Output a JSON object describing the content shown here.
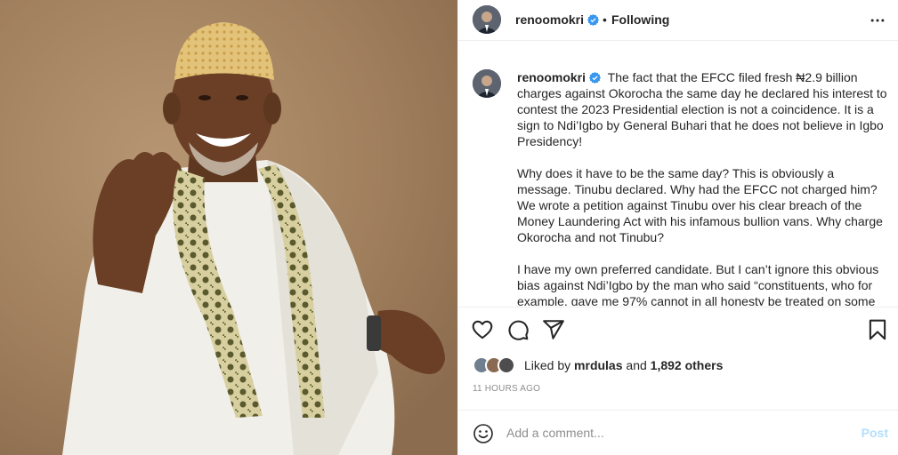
{
  "header": {
    "username": "renoomokri",
    "separator": "•",
    "follow_status": "Following"
  },
  "caption": {
    "username": "renoomokri",
    "paragraphs": [
      "The fact that the EFCC filed fresh ₦2.9 billion charges against Okorocha the same day he declared his interest to contest the 2023 Presidential election is not a coincidence. It is a sign to Ndi’Igbo by General Buhari that he does not believe in Igbo Presidency!",
      "Why does it have to be the same day? This is obviously a message. Tinubu declared. Why had the EFCC not charged him? We wrote a petition against Tinubu over his clear breach of the Money Laundering Act with his infamous bullion vans. Why charge Okorocha and not Tinubu?",
      "I have my own preferred candidate. But I can’t ignore this obvious bias against Ndi’Igbo by the man who said “constituents, who for example, gave me 97% cannot in all honesty be treated on some"
    ]
  },
  "likes": {
    "prefix": "Liked by",
    "user": "mrdulas",
    "middle": "and",
    "count": "1,892 others"
  },
  "timestamp": "11 HOURS AGO",
  "comment": {
    "placeholder": "Add a comment...",
    "post_label": "Post"
  },
  "icons": {
    "verified": "verified-badge-icon",
    "more": "more-options-icon",
    "like": "heart-icon",
    "comment": "comment-icon",
    "share": "share-icon",
    "save": "bookmark-icon",
    "emoji": "emoji-icon"
  },
  "colors": {
    "verified": "#3897f0",
    "post_button": "#b2dffc",
    "muted": "#8e8e8e"
  }
}
